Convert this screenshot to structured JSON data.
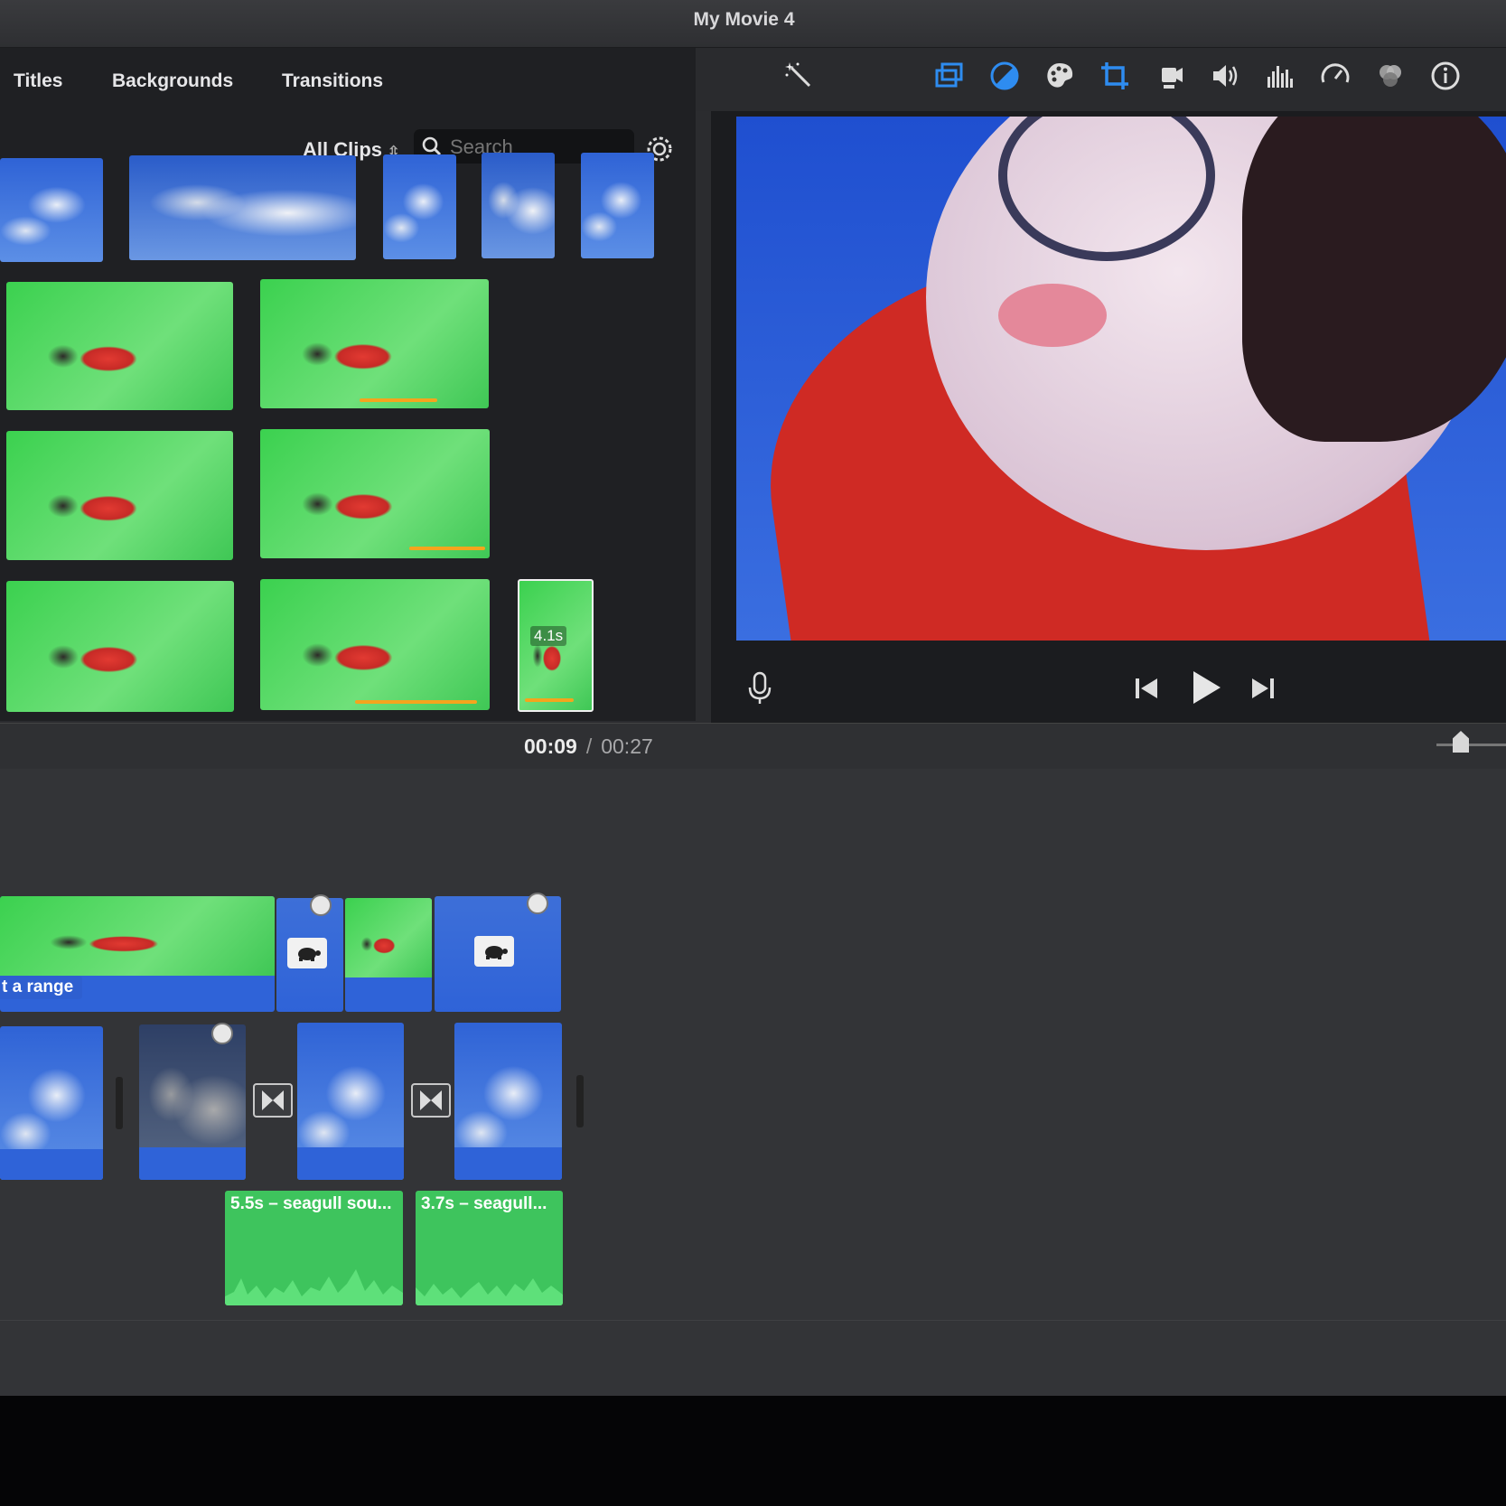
{
  "window": {
    "title": "My Movie 4"
  },
  "browser_tabs": [
    "Titles",
    "Backgrounds",
    "Transitions"
  ],
  "filter": {
    "selected": "All Clips",
    "search_placeholder": "Search"
  },
  "toolbar_icons": [
    "magic-wand-icon",
    "video-overlay-icon",
    "color-balance-icon",
    "color-correction-icon",
    "crop-icon",
    "stabilization-icon",
    "volume-icon",
    "equalizer-icon",
    "speed-icon",
    "clip-filter-icon",
    "info-icon"
  ],
  "browser_clip_badge": "4.1s",
  "playback": {
    "current_time": "00:09",
    "separator": "/",
    "total_time": "00:27"
  },
  "timeline": {
    "range_label": "t a range",
    "audio_clips": [
      {
        "label": "5.5s – seagull sou..."
      },
      {
        "label": "3.7s – seagull..."
      }
    ]
  },
  "colors": {
    "accent_blue": "#2f63d8",
    "audio_green": "#3ec45d",
    "progress_orange": "#f4a51d",
    "toolbar_active_blue": "#2e8cf0"
  }
}
